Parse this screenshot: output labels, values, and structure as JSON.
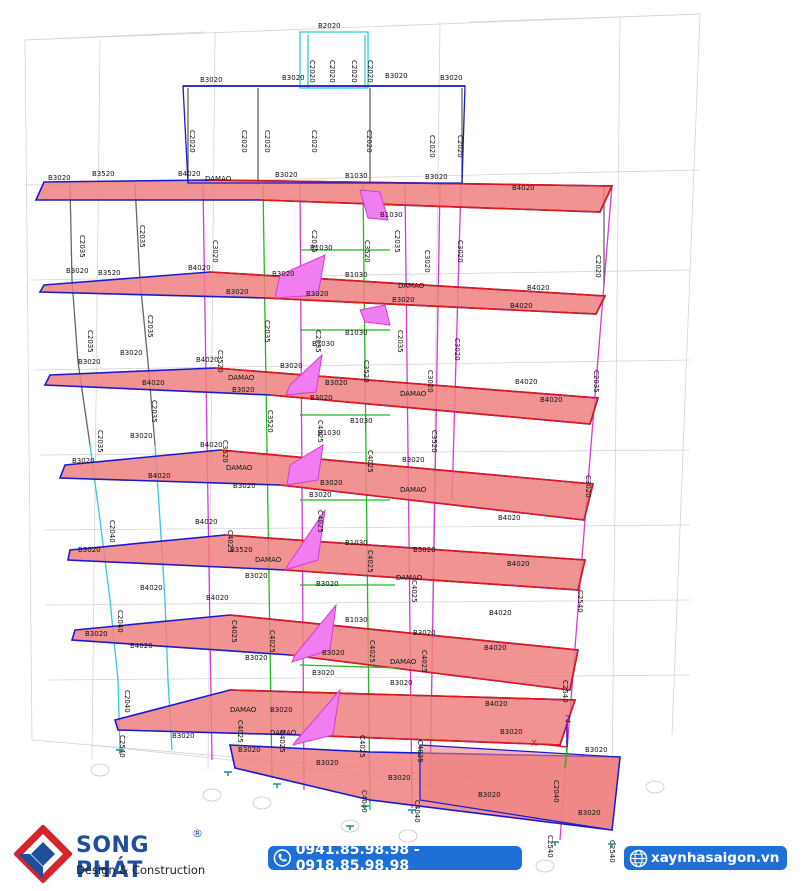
{
  "model": {
    "labels": {
      "b3020": "B3020",
      "b4020": "B4020",
      "b1030": "B1030",
      "b3520": "B3520",
      "b2020": "B2020",
      "damao": "DAMAO",
      "c2020": "C2020",
      "c2035": "C2035",
      "c3020": "C3020",
      "c3520": "C3520",
      "c2040": "C2040",
      "c4025": "C4025",
      "c4040": "C4040",
      "c2540": "C2540",
      "axis_z": "Z",
      "axis_x": "X"
    },
    "colors": {
      "slab_fill": "#f08080",
      "slab_edge_blue": "#1a1acc",
      "slab_edge_red": "#e01818",
      "column_gray": "#666666",
      "column_magenta": "#d63ad6",
      "column_cyan": "#35c8d8",
      "column_green": "#23b823",
      "stair_fill": "#f07ef0",
      "grid_gray": "#d4d4d4",
      "support_teal": "#1c8f8f"
    }
  },
  "footer": {
    "brand_name": "SONG PHÁT",
    "brand_reg": "®",
    "brand_tagline": "Design & Construction",
    "phones": "0941.85.98.98 - 0918.85.98.98",
    "website": "xaynhasaigon.vn",
    "colors": {
      "brand_blue": "#1f4e9c",
      "brand_red": "#d8232a",
      "pill_blue": "#1e6fd6"
    },
    "icons": {
      "logo": "song-phat-logo-icon",
      "phone": "phone-icon",
      "web": "globe-icon"
    }
  }
}
